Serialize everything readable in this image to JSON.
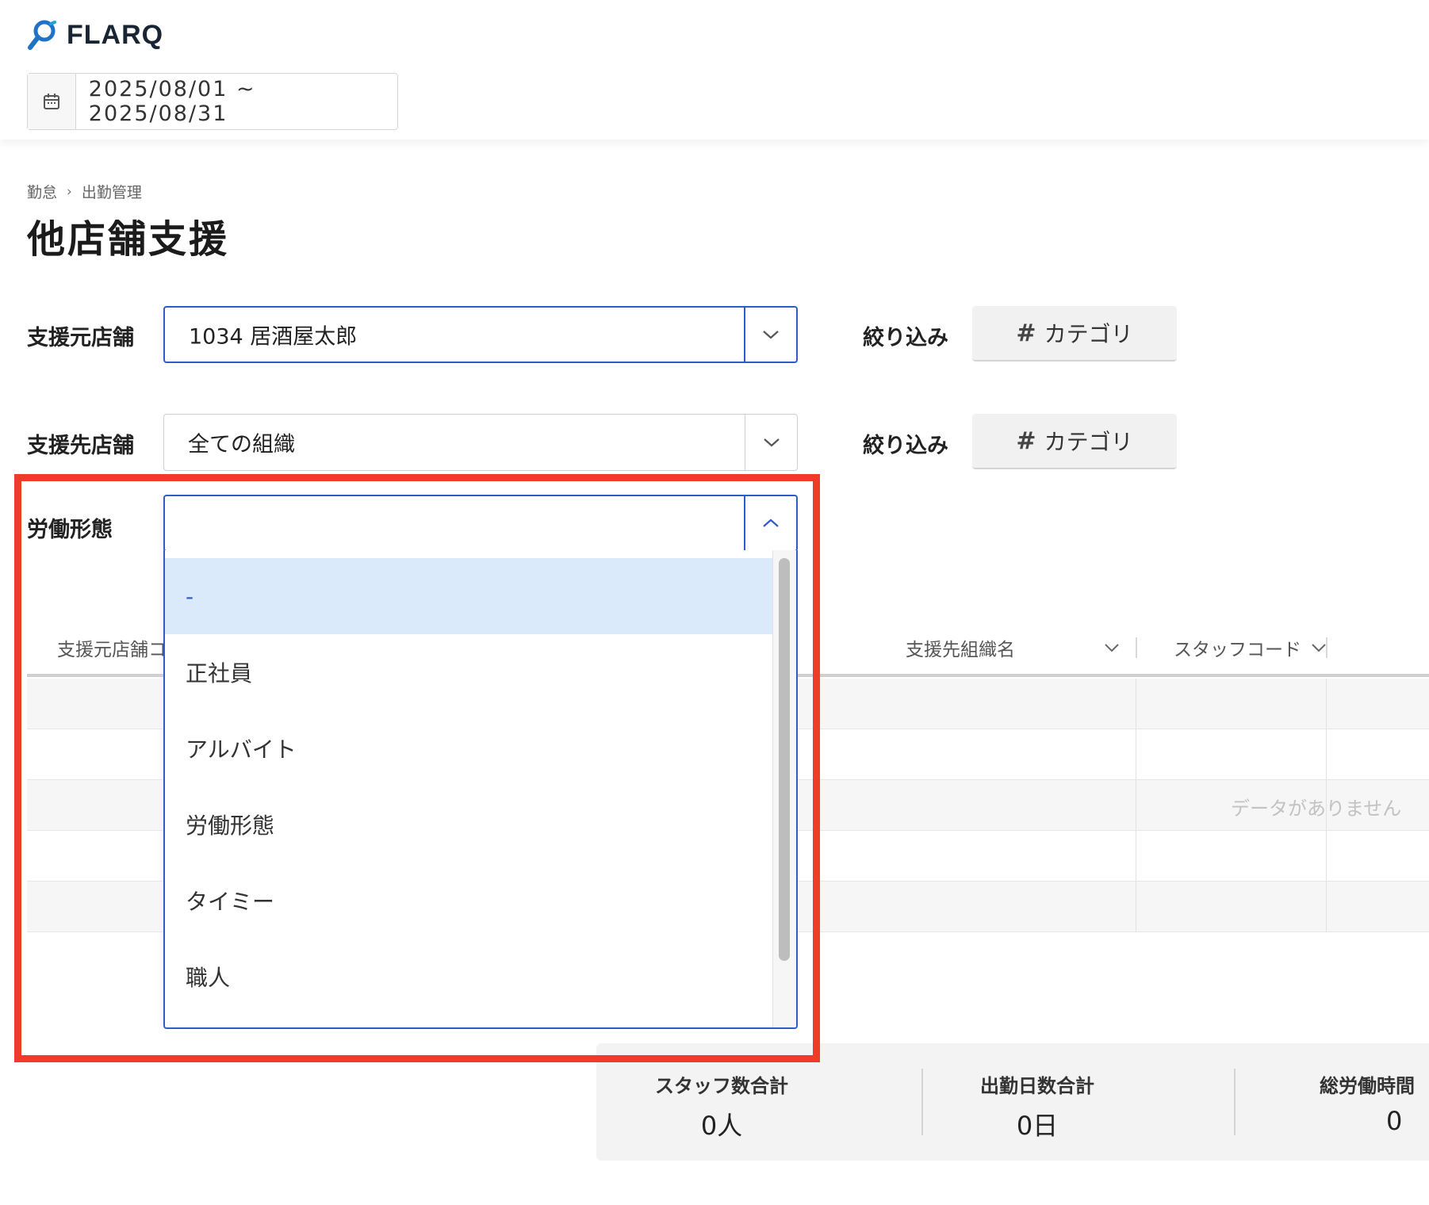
{
  "app": {
    "logo_text": "FLARQ",
    "brand_color": "#1f72c6"
  },
  "header": {
    "date_range": "2025/08/01 ~ 2025/08/31",
    "date_icon": "calendar-icon"
  },
  "breadcrumb": {
    "items": [
      "勤怠",
      "出勤管理"
    ],
    "separator_icon": "chevron-right-icon"
  },
  "page": {
    "title": "他店舗支援"
  },
  "filters": {
    "source_store": {
      "label": "支援元店舗",
      "value": "1034 居酒屋太郎",
      "filter_label": "絞り込み",
      "category_button": "カテゴリ"
    },
    "destination_store": {
      "label": "支援先店舗",
      "value": "全ての組織",
      "filter_label": "絞り込み",
      "category_button": "カテゴリ"
    },
    "employment_type": {
      "label": "労働形態",
      "value": "",
      "options": [
        "-",
        "正社員",
        "アルバイト",
        "労働形態",
        "タイミー",
        "職人"
      ],
      "selected_index": 0
    }
  },
  "table": {
    "columns": [
      "支援元店舗コ",
      "支援先組織名",
      "スタッフコード"
    ],
    "empty_message": "データがありません"
  },
  "summary": {
    "staff_total": {
      "label": "スタッフ数合計",
      "value": "0人"
    },
    "attendance_days_total": {
      "label": "出勤日数合計",
      "value": "0日"
    },
    "total_work_hours": {
      "label": "総労働時間",
      "value": "0"
    }
  },
  "colors": {
    "accent": "#2f5cc9",
    "selected_bg": "#dbeafb",
    "annotation": "#f03a2a"
  }
}
